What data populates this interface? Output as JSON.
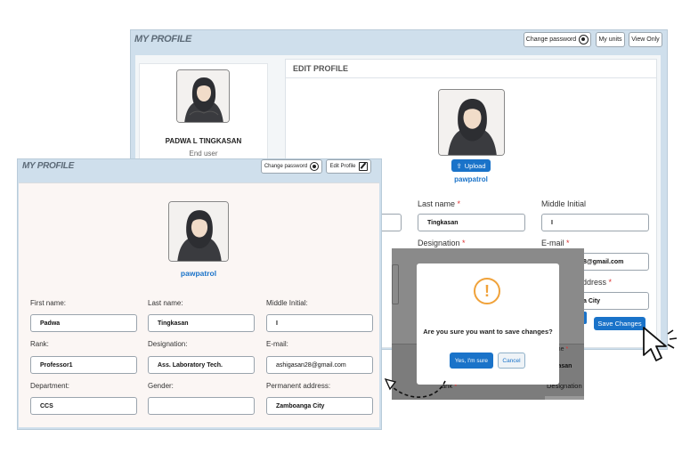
{
  "back_window": {
    "title": "MY PROFILE",
    "header_buttons": {
      "change_password": "Change password",
      "my_units": "My units",
      "view_only": "View Only"
    },
    "profile_card": {
      "name": "PADWA L TINGKASAN",
      "role": "End user"
    },
    "edit_profile": {
      "heading": "EDIT PROFILE",
      "upload_label": "Upload",
      "username": "pawpatrol",
      "fields": {
        "last_name_label": "Last name",
        "last_name_value": "Tingkasan",
        "middle_initial_label": "Middle Initial",
        "middle_initial_value": "I",
        "designation_label": "Designation",
        "email_label": "E-mail",
        "email_partial": "8@gmail.com",
        "address_label": "ddress",
        "address_partial": "a City",
        "required_mark": "*"
      },
      "save_button": "Save Changes"
    }
  },
  "modal": {
    "icon": "exclamation-icon",
    "glyph": "!",
    "message": "Are you sure you want to save changes?",
    "confirm": "Yes, I'm sure",
    "cancel": "Cancel",
    "behind": {
      "name_partial": "name",
      "tingkasan_partial": "ngkasan",
      "rank_partial": "ank",
      "designation_partial": "Designation"
    }
  },
  "front_window": {
    "title": "MY PROFILE",
    "header_buttons": {
      "change_password": "Change password",
      "edit_profile": "Edit Profile"
    },
    "username": "pawpatrol",
    "fields": [
      {
        "key": "first_name",
        "label": "First name:",
        "value": "Padwa"
      },
      {
        "key": "last_name",
        "label": "Last name:",
        "value": "Tingkasan"
      },
      {
        "key": "middle_initial",
        "label": "Middle Initial:",
        "value": "I"
      },
      {
        "key": "rank",
        "label": "Rank:",
        "value": "Professor1"
      },
      {
        "key": "designation",
        "label": "Designation:",
        "value": "Ass. Laboratory Tech."
      },
      {
        "key": "email",
        "label": "E-mail:",
        "value": "ashigasan28@gmail.com"
      },
      {
        "key": "department",
        "label": "Department:",
        "value": "CCS"
      },
      {
        "key": "gender",
        "label": "Gender:",
        "value": ""
      },
      {
        "key": "address",
        "label": "Permanent address:",
        "value": "Zamboanga City"
      }
    ]
  },
  "colors": {
    "accent": "#1a73c9",
    "warning": "#f0a23a",
    "header_bg": "#cfdfec"
  }
}
